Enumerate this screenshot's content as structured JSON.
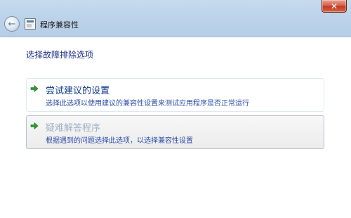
{
  "window": {
    "title": "程序兼容性",
    "close_label": "✕"
  },
  "content": {
    "heading": "选择故障排除选项",
    "options": [
      {
        "title": "尝试建议的设置",
        "description": "选择此选项以使用建议的兼容性设置来测试应用程序是否正常运行"
      },
      {
        "title": "疑难解答程序",
        "description": "根据遇到的问题选择此选项，以选择兼容性设置"
      }
    ]
  },
  "icons": {
    "back": "back-arrow-icon",
    "app": "program-compatibility-icon",
    "option_arrow": "green-arrow-icon"
  },
  "colors": {
    "arrow_green": "#2e9b2e",
    "heading_blue": "#1e3287",
    "titlebar": "#bcd3ea",
    "close_red": "#c43b22"
  }
}
